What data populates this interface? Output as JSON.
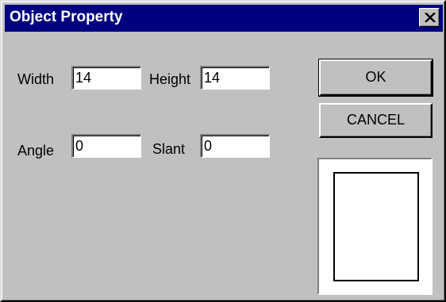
{
  "dialog": {
    "title": "Object Property"
  },
  "fields": {
    "width_label": "Width",
    "width_value": "14",
    "height_label": "Height",
    "height_value": "14",
    "angle_label": "Angle",
    "angle_value": "0",
    "slant_label": "Slant",
    "slant_value": "0"
  },
  "buttons": {
    "ok_label": "OK",
    "cancel_label": "CANCEL"
  },
  "icons": {
    "close": "close-icon"
  },
  "colors": {
    "titlebar": "#000080",
    "face": "#c0c0c0"
  }
}
